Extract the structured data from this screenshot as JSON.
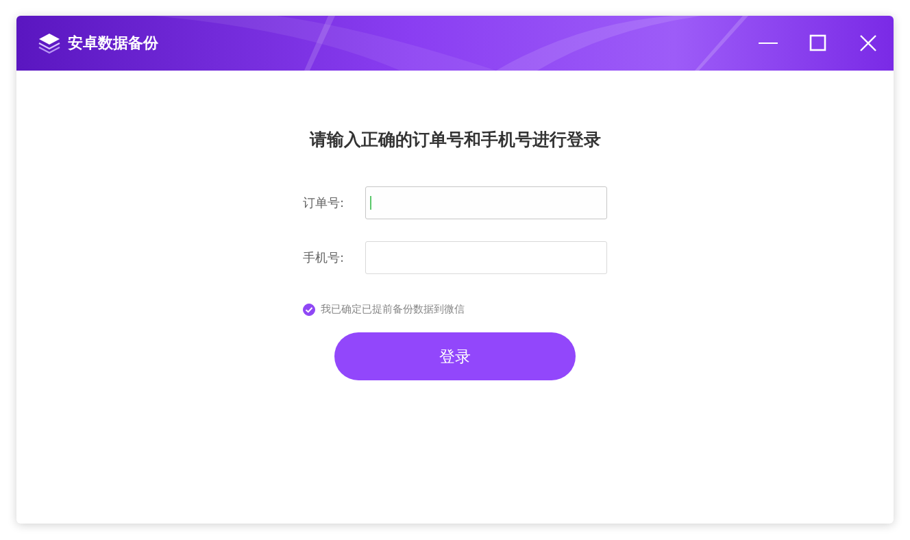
{
  "window": {
    "title": "安卓数据备份"
  },
  "heading": "请输入正确的订单号和手机号进行登录",
  "fields": [
    {
      "label": "订单号:",
      "focused": true
    },
    {
      "label": "手机号:",
      "focused": false
    }
  ],
  "agreement": {
    "label": "我已确定已提前备份数据到微信",
    "checked": true
  },
  "login_button": "登录"
}
